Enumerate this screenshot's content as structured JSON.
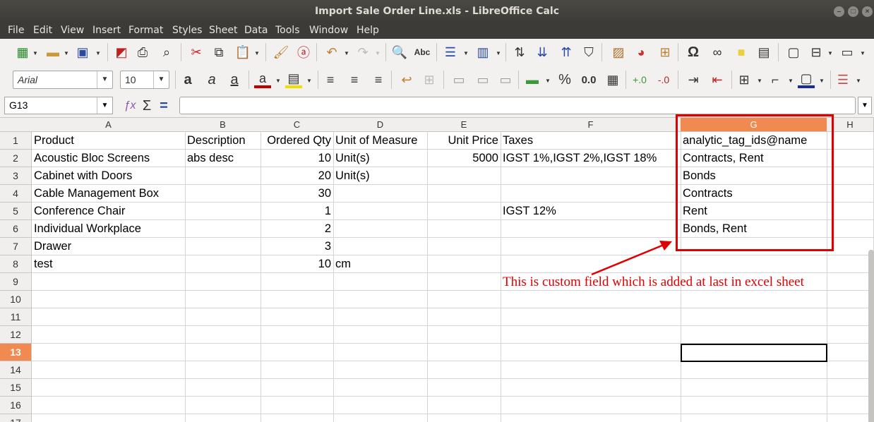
{
  "window": {
    "title": "Import Sale Order Line.xls - LibreOffice Calc"
  },
  "menu": [
    "File",
    "Edit",
    "View",
    "Insert",
    "Format",
    "Styles",
    "Sheet",
    "Data",
    "Tools",
    "Window",
    "Help"
  ],
  "toolbar": {
    "font_name": "Arial",
    "font_size": "10",
    "bold_label": "a",
    "italic_label": "a",
    "underline_label": "a",
    "percent_label": "%",
    "decimal_label": "0.0",
    "omega_label": "Ω",
    "spell_label": "Abc"
  },
  "formula_bar": {
    "cell_ref": "G13",
    "sum_label": "Σ",
    "eq_label": "="
  },
  "columns": [
    "A",
    "B",
    "C",
    "D",
    "E",
    "F",
    "G",
    "H"
  ],
  "selected_column": "G",
  "rows": [
    "1",
    "2",
    "3",
    "4",
    "5",
    "6",
    "7",
    "8",
    "9",
    "10",
    "11",
    "12",
    "13",
    "14",
    "15",
    "16",
    "17"
  ],
  "selected_row": "13",
  "cells": [
    [
      "Product",
      "Description",
      "Ordered Qty",
      "Unit of Measure",
      "Unit Price",
      "Taxes",
      "analytic_tag_ids@name"
    ],
    [
      "Acoustic Bloc Screens",
      "abs desc",
      "10",
      "Unit(s)",
      "5000",
      "IGST 1%,IGST 2%,IGST 18%",
      "Contracts, Rent"
    ],
    [
      "Cabinet with Doors",
      "",
      "20",
      "Unit(s)",
      "",
      "",
      "Bonds"
    ],
    [
      "Cable Management Box",
      "",
      "30",
      "",
      "",
      "",
      "Contracts"
    ],
    [
      "Conference Chair",
      "",
      "1",
      "",
      "",
      "IGST 12%",
      "Rent"
    ],
    [
      "Individual Workplace",
      "",
      "2",
      "",
      "",
      "",
      "Bonds, Rent"
    ],
    [
      "Drawer",
      "",
      "3",
      "",
      "",
      "",
      ""
    ],
    [
      "test",
      "",
      "10",
      "cm",
      "",
      "",
      ""
    ]
  ],
  "annotation": {
    "text": "This is custom field which is added at last in excel sheet",
    "color": "#e00000"
  },
  "colors": {
    "selection": "#f08a50",
    "titlebar": "#3c3b37"
  }
}
